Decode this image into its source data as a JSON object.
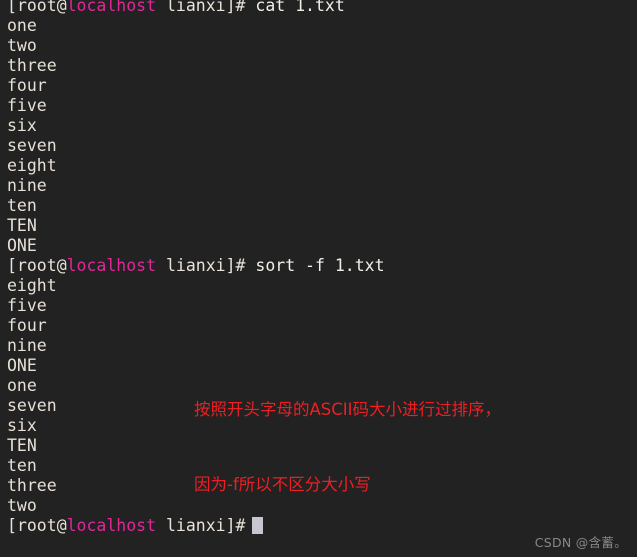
{
  "terminal": {
    "background_color": "#222222",
    "foreground_color": "#e8e2d8",
    "host_color": "#e1269a",
    "annotation_color": "#ec2024",
    "cursor_color": "#c6c6d2",
    "prompt": {
      "open_bracket": "[",
      "user": "root",
      "at": "@",
      "host": "localhost",
      "space": " ",
      "path": "lianxi",
      "close": "]#"
    },
    "scrollback_top_partial": "two",
    "lines": [
      {
        "type": "prompt",
        "command": " cat 1.txt"
      },
      {
        "type": "output",
        "text": "one"
      },
      {
        "type": "output",
        "text": "two"
      },
      {
        "type": "output",
        "text": "three"
      },
      {
        "type": "output",
        "text": "four"
      },
      {
        "type": "output",
        "text": "five"
      },
      {
        "type": "output",
        "text": "six"
      },
      {
        "type": "output",
        "text": "seven"
      },
      {
        "type": "output",
        "text": "eight"
      },
      {
        "type": "output",
        "text": "nine"
      },
      {
        "type": "output",
        "text": "ten"
      },
      {
        "type": "output",
        "text": "TEN"
      },
      {
        "type": "output",
        "text": "ONE"
      },
      {
        "type": "prompt",
        "command": " sort -f 1.txt"
      },
      {
        "type": "output",
        "text": "eight"
      },
      {
        "type": "output",
        "text": "five"
      },
      {
        "type": "output",
        "text": "four"
      },
      {
        "type": "output",
        "text": "nine"
      },
      {
        "type": "output",
        "text": "ONE"
      },
      {
        "type": "output",
        "text": "one"
      },
      {
        "type": "output",
        "text": "seven"
      },
      {
        "type": "output",
        "text": "six"
      },
      {
        "type": "output",
        "text": "TEN"
      },
      {
        "type": "output",
        "text": "ten"
      },
      {
        "type": "output",
        "text": "three"
      },
      {
        "type": "output",
        "text": "two"
      },
      {
        "type": "prompt_cursor",
        "command": ""
      }
    ]
  },
  "annotation": {
    "line1": "按照开头字母的ASCII码大小进行过排序，",
    "line2": "因为-f所以不区分大小写"
  },
  "watermark": {
    "text": "CSDN @含蓄。"
  }
}
